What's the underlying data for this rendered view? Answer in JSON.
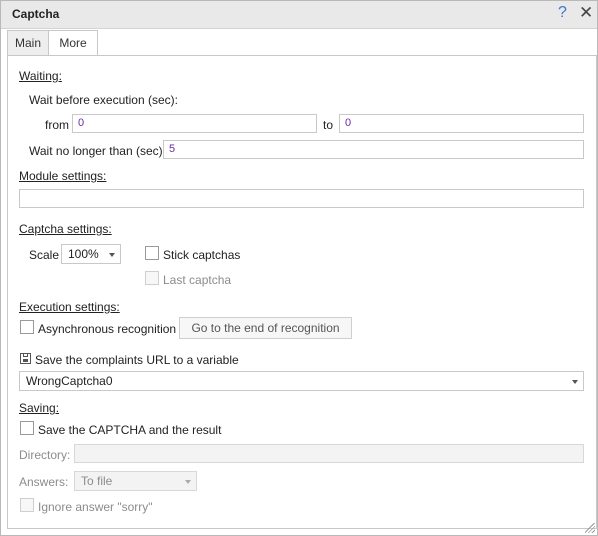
{
  "window": {
    "title": "Captcha"
  },
  "tabs": [
    {
      "label": "Main"
    },
    {
      "label": "More"
    }
  ],
  "waiting": {
    "section": "Waiting:",
    "wait_before_label": "Wait before execution (sec):",
    "from_label": "from",
    "from_value": "0",
    "to_label": "to",
    "to_value": "0",
    "wait_no_longer_label": "Wait no longer than (sec):",
    "wait_no_longer_value": "5"
  },
  "module": {
    "section": "Module settings:",
    "value": ""
  },
  "captcha": {
    "section": "Captcha settings:",
    "scale_label": "Scale",
    "scale_value": "100%",
    "stick_label": "Stick captchas",
    "last_label": "Last captcha"
  },
  "execution": {
    "section": "Execution settings:",
    "async_label": "Asynchronous recognition",
    "goto_button": "Go to the end of recognition"
  },
  "complaints": {
    "label": "Save the complaints URL to a variable",
    "value": "WrongCaptcha0"
  },
  "saving": {
    "section": "Saving:",
    "save_label": "Save the CAPTCHA and the result",
    "directory_label": "Directory:",
    "directory_value": "",
    "answers_label": "Answers:",
    "answers_value": "To file",
    "ignore_label": "Ignore answer \"sorry\""
  }
}
